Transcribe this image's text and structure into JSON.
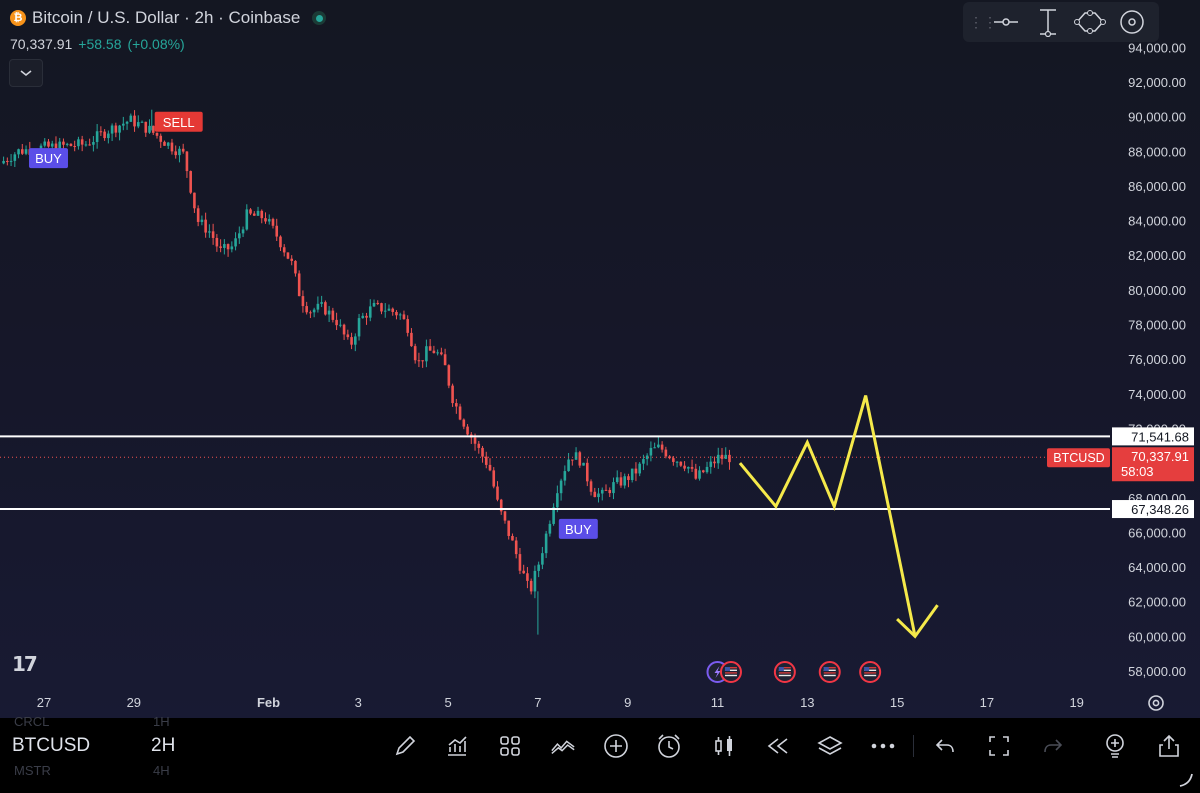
{
  "header": {
    "symbol_title": "Bitcoin / U.S. Dollar · 2h · Coinbase",
    "btc_glyph": "₿",
    "last_price": "70,337.91",
    "change": "+58.58",
    "change_pct": "(+0.08%)"
  },
  "toolbar_icons": [
    "drag-handle-icon",
    "horizontal-ray-icon",
    "vertical-measure-icon",
    "ellipse-path-icon",
    "circle-target-icon"
  ],
  "watermark": "17",
  "bottom_bar": {
    "symbol": "BTCUSD",
    "interval": "2H",
    "ghost_symbols": [
      "CRCL",
      "MSTR"
    ],
    "ghost_intervals": [
      "1H",
      "4H"
    ],
    "icons": [
      "draw-pen-icon",
      "indicators-icon",
      "templates-grid-icon",
      "compare-wave-icon",
      "add-plus-icon",
      "alert-clock-icon",
      "candle-type-icon",
      "replay-icon",
      "layers-icon",
      "more-icon",
      "undo-icon",
      "fullscreen-icon",
      "redo-icon",
      "idea-bulb-icon",
      "share-icon"
    ]
  },
  "colors": {
    "up": "#26a69a",
    "down": "#ef5350",
    "buy_badge": "#5b4ee8",
    "sell_badge": "#e53935",
    "projection": "#f5e94a",
    "level_line": "#ffffff",
    "price_label": "#e53e3e"
  },
  "chart_data": {
    "type": "candlestick",
    "symbol": "BTCUSD",
    "interval": "2h",
    "y_axis_ticks": [
      58000,
      60000,
      62000,
      64000,
      66000,
      68000,
      70000,
      72000,
      74000,
      76000,
      78000,
      80000,
      82000,
      84000,
      86000,
      88000,
      90000,
      92000,
      94000
    ],
    "y_axis_tick_labels": [
      "58,000.00",
      "60,000.00",
      "62,000.00",
      "64,000.00",
      "66,000.00",
      "68,000.00",
      "70,000.00",
      "72,000.00",
      "74,000.00",
      "76,000.00",
      "78,000.00",
      "80,000.00",
      "82,000.00",
      "84,000.00",
      "86,000.00",
      "88,000.00",
      "90,000.00",
      "92,000.00",
      "94,000.00"
    ],
    "x_axis_ticks": [
      {
        "label": "27",
        "day": 27
      },
      {
        "label": "29",
        "day": 29
      },
      {
        "label": "Feb",
        "day": 32
      },
      {
        "label": "3",
        "day": 34
      },
      {
        "label": "5",
        "day": 36
      },
      {
        "label": "7",
        "day": 38
      },
      {
        "label": "9",
        "day": 40
      },
      {
        "label": "11",
        "day": 42
      },
      {
        "label": "13",
        "day": 44
      },
      {
        "label": "15",
        "day": 46
      },
      {
        "label": "17",
        "day": 48
      },
      {
        "label": "19",
        "day": 50
      }
    ],
    "price_path": [
      [
        26.1,
        87300
      ],
      [
        26.5,
        88000
      ],
      [
        27.0,
        88200
      ],
      [
        27.5,
        88300
      ],
      [
        28.0,
        88400
      ],
      [
        28.5,
        89200
      ],
      [
        29.0,
        89800
      ],
      [
        29.4,
        89300
      ],
      [
        29.8,
        88500
      ],
      [
        30.2,
        87800
      ],
      [
        30.5,
        84000
      ],
      [
        30.8,
        83300
      ],
      [
        31.0,
        82200
      ],
      [
        31.3,
        82500
      ],
      [
        31.6,
        84300
      ],
      [
        32.0,
        84200
      ],
      [
        32.3,
        83000
      ],
      [
        32.6,
        81500
      ],
      [
        32.8,
        79500
      ],
      [
        33.0,
        78800
      ],
      [
        33.3,
        79000
      ],
      [
        33.6,
        78200
      ],
      [
        33.9,
        76700
      ],
      [
        34.1,
        78200
      ],
      [
        34.4,
        79000
      ],
      [
        34.7,
        78900
      ],
      [
        35.0,
        78600
      ],
      [
        35.2,
        77800
      ],
      [
        35.4,
        75700
      ],
      [
        35.6,
        76400
      ],
      [
        35.8,
        76500
      ],
      [
        36.0,
        75700
      ],
      [
        36.2,
        73600
      ],
      [
        36.5,
        72000
      ],
      [
        36.8,
        70600
      ],
      [
        37.0,
        69800
      ],
      [
        37.2,
        67500
      ],
      [
        37.5,
        65500
      ],
      [
        37.7,
        64000
      ],
      [
        37.9,
        62500
      ],
      [
        38.1,
        64200
      ],
      [
        38.3,
        66200
      ],
      [
        38.5,
        68500
      ],
      [
        38.8,
        70500
      ],
      [
        39.0,
        70300
      ],
      [
        39.3,
        68400
      ],
      [
        39.5,
        68100
      ],
      [
        39.8,
        68800
      ],
      [
        40.0,
        69000
      ],
      [
        40.3,
        69600
      ],
      [
        40.6,
        70700
      ],
      [
        40.8,
        70900
      ],
      [
        41.1,
        70300
      ],
      [
        41.4,
        69900
      ],
      [
        41.6,
        69100
      ],
      [
        41.9,
        69800
      ],
      [
        42.1,
        70300
      ],
      [
        42.3,
        70338
      ]
    ],
    "wicks": {
      "extreme_high": [
        29.4,
        90400
      ],
      "extreme_low": [
        38.0,
        60100
      ]
    },
    "horizontal_levels": [
      71541.68,
      67348.26
    ],
    "level_labels": [
      "71,541.68",
      "67,348.26"
    ],
    "current_price_label": {
      "symbol": "BTCUSD",
      "price": "70,337.91",
      "countdown": "58:03"
    },
    "signals": [
      {
        "text": "BUY",
        "day": 27.1,
        "price": 87600,
        "kind": "buy"
      },
      {
        "text": "SELL",
        "day": 30.0,
        "price": 89700,
        "kind": "sell"
      },
      {
        "text": "BUY",
        "day": 38.9,
        "price": 66200,
        "kind": "buy"
      }
    ],
    "projection_path": [
      [
        42.5,
        70000
      ],
      [
        43.3,
        67500
      ],
      [
        44.0,
        71200
      ],
      [
        44.6,
        67500
      ],
      [
        45.3,
        73900
      ],
      [
        46.4,
        60000
      ]
    ],
    "projection_arrowhead": [
      [
        46.0,
        61000
      ],
      [
        46.4,
        60000
      ],
      [
        46.9,
        61800
      ]
    ],
    "event_markers": [
      {
        "day": 42.0,
        "kind": "bolt"
      },
      {
        "day": 42.3,
        "kind": "flag"
      },
      {
        "day": 43.5,
        "kind": "flag"
      },
      {
        "day": 44.5,
        "kind": "flag"
      },
      {
        "day": 45.4,
        "kind": "flag"
      }
    ]
  }
}
